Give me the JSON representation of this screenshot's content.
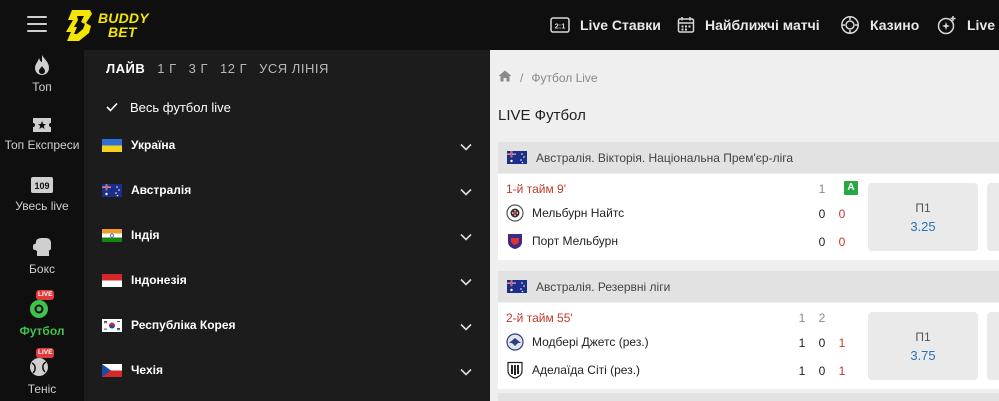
{
  "header": {
    "logo": {
      "line1": "BUDDY",
      "line2": "BET"
    },
    "nav": [
      {
        "label": "Live Ставки",
        "icon": "live-score-icon",
        "icon_text": "2:1"
      },
      {
        "label": "Найближчі матчі",
        "icon": "calendar-icon"
      },
      {
        "label": "Казино",
        "icon": "casino-chip-icon"
      },
      {
        "label": "Live",
        "icon": "live-casino-icon"
      }
    ]
  },
  "sidebar": {
    "items": [
      {
        "label": "Топ",
        "icon": "flame-icon"
      },
      {
        "label": "Топ Експреси",
        "icon": "ticket-icon"
      },
      {
        "label": "Увесь live",
        "icon": "counter-icon",
        "icon_text": "109"
      },
      {
        "label": "Бокс",
        "icon": "boxing-glove-icon"
      },
      {
        "label": "Футбол",
        "icon": "football-icon",
        "badge": "LIVE",
        "active": true
      },
      {
        "label": "Теніс",
        "icon": "tennis-ball-icon",
        "badge": "LIVE"
      }
    ]
  },
  "filters": {
    "tabs": [
      {
        "label": "ЛАЙВ",
        "active": true
      },
      {
        "label": "1 Г"
      },
      {
        "label": "3 Г"
      },
      {
        "label": "12 Г"
      },
      {
        "label": "УСЯ ЛІНІЯ"
      }
    ],
    "all_live": "Весь футбол live",
    "countries": [
      {
        "name": "Україна",
        "flag": "ukraine-flag"
      },
      {
        "name": "Австралія",
        "flag": "australia-flag"
      },
      {
        "name": "Індія",
        "flag": "india-flag"
      },
      {
        "name": "Індонезія",
        "flag": "indonesia-flag"
      },
      {
        "name": "Республіка Корея",
        "flag": "korea-flag"
      },
      {
        "name": "Чехія",
        "flag": "czechia-flag"
      }
    ]
  },
  "content": {
    "breadcrumb": {
      "home_icon": "home-icon",
      "current": "Футбол Live"
    },
    "title": "LIVE Футбол",
    "leagues": [
      {
        "name": "Австралія. Вікторія. Національна Прем'єр-ліга",
        "match": {
          "time": "1-й тайм 9'",
          "period_headers": [
            "1"
          ],
          "badge": "A",
          "teams": [
            {
              "name": "Мельбурн Найтс",
              "scores": [
                "0"
              ],
              "total": "0"
            },
            {
              "name": "Порт Мельбурн",
              "scores": [
                "0"
              ],
              "total": "0"
            }
          ],
          "odds": {
            "label": "П1",
            "value": "3.25"
          }
        }
      },
      {
        "name": "Австралія. Резервні ліги",
        "match": {
          "time": "2-й тайм 55'",
          "period_headers": [
            "1",
            "2"
          ],
          "teams": [
            {
              "name": "Модбері Джетс (рез.)",
              "scores": [
                "1",
                "0"
              ],
              "total": "1"
            },
            {
              "name": "Аделаїда Сіті (рез.)",
              "scores": [
                "1",
                "0"
              ],
              "total": "1"
            }
          ],
          "odds": {
            "label": "П1",
            "value": "3.75"
          }
        }
      }
    ]
  },
  "colors": {
    "brand_yellow": "#f3e600",
    "active_green": "#3ec44c",
    "live_red": "#e23a3a",
    "odds_blue": "#2673b8"
  }
}
